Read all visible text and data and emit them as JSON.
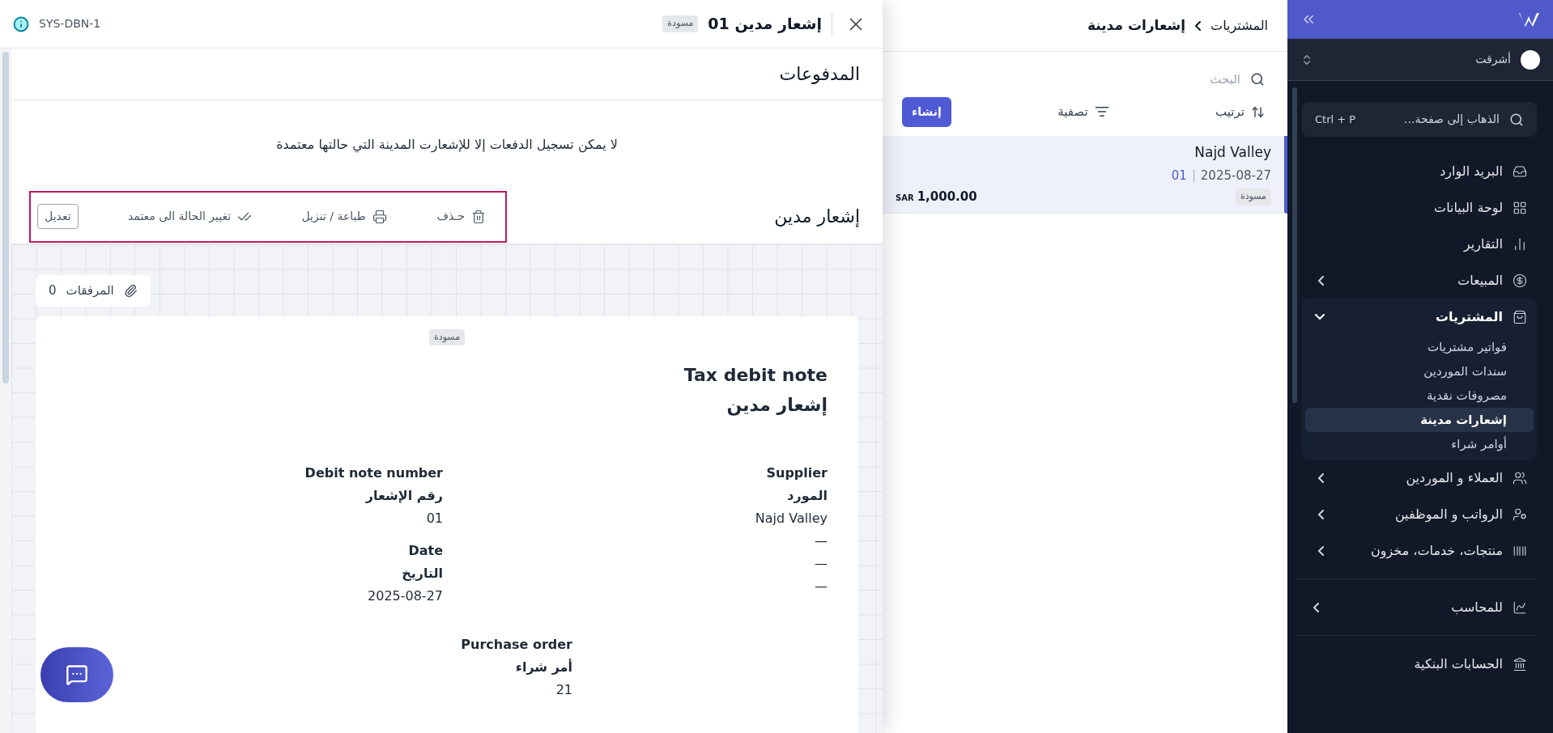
{
  "drawer": {
    "title": "إشعار مدين 01",
    "status": "مسودة",
    "reference": "SYS-DBN-1",
    "payments": {
      "heading": "المدفوعات",
      "message": "لا يمكن تسجيل الدفعات إلا للإشعارت المدينة التي حالتها معتمدة"
    },
    "note": {
      "heading": "إشعار مدين",
      "actions": [
        {
          "kind": "delete",
          "label": "حـذف"
        },
        {
          "kind": "print",
          "label": "طباعة / تنزيل"
        },
        {
          "kind": "approve",
          "label": "تغيير الحالة الى معتمد"
        },
        {
          "kind": "edit",
          "label": "تعديل"
        }
      ]
    },
    "attachments": {
      "label": "المرفقات",
      "count": "0"
    },
    "document": {
      "status": "مسودة",
      "title_en": "Tax debit note",
      "title_ar": "إشعار مدين",
      "supplier": {
        "label_en": "Supplier",
        "label_ar": "المورد",
        "lines": [
          "Najd Valley",
          "—",
          "—",
          "—"
        ]
      },
      "fields": [
        {
          "label_en": "Debit note number",
          "label_ar": "رقم الإشعار",
          "value": "01"
        },
        {
          "label_en": "Date",
          "label_ar": "التاريخ",
          "value": "2025-08-27"
        }
      ],
      "purchase_order": {
        "label_en": "Purchase order",
        "label_ar": "أمر شراء",
        "value": "21"
      }
    }
  },
  "list": {
    "breadcrumb": [
      "المشتريات",
      "إشعارات مدينة"
    ],
    "search": {
      "placeholder": "البحث"
    },
    "sort": "ترتيب",
    "filter": "تصفية",
    "create": "إنشاء",
    "rows": [
      {
        "name": "Najd Valley",
        "date": "2025-08-27",
        "number": "01",
        "status": "مسودة",
        "currency": "SAR",
        "amount": "1,000.00",
        "selected": true
      }
    ]
  },
  "sidebar": {
    "org": "أشرقت",
    "search": {
      "placeholder": "الذهاب إلى صفحة...",
      "shortcut": "Ctrl + P"
    },
    "groups": [
      [
        {
          "label": "البريد الوارد"
        },
        {
          "label": "لوحة البيانات"
        },
        {
          "label": "التقارير"
        },
        {
          "label": "المبيعات",
          "expanded": false
        },
        {
          "label": "المشتريات",
          "expanded": true,
          "children": [
            {
              "label": "فواتير مشتريات",
              "selected": false
            },
            {
              "label": "سندات الموردين",
              "selected": false
            },
            {
              "label": "مصروفات نقدية",
              "selected": false
            },
            {
              "label": "إشعارات مدينة",
              "selected": true
            },
            {
              "label": "أوامر شراء",
              "selected": false
            }
          ]
        },
        {
          "label": "العملاء و الموردين",
          "expanded": false
        },
        {
          "label": "الرواتب و الموظفين",
          "expanded": false
        },
        {
          "label": "منتجات، خدمات، مخزون",
          "expanded": false
        }
      ],
      [
        {
          "label": "للمحاسب",
          "expanded": false
        }
      ],
      [
        {
          "label": "الحسابات البنكية"
        }
      ]
    ]
  }
}
